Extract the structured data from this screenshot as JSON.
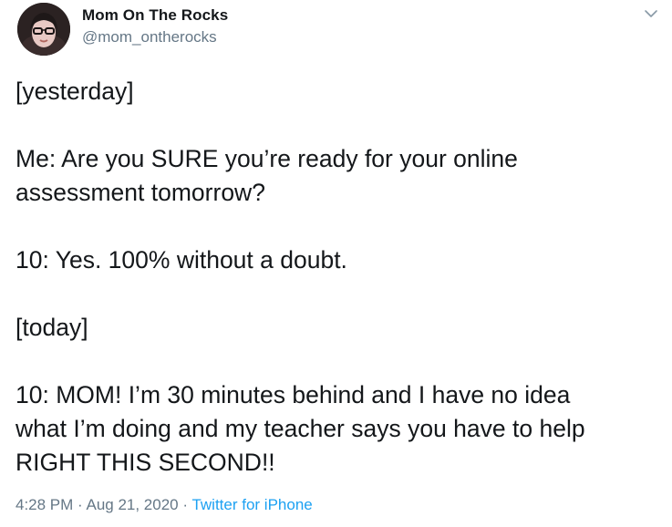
{
  "author": {
    "display_name": "Mom On The Rocks",
    "handle": "@mom_ontherocks"
  },
  "icons": {
    "menu": "chevron-down-icon",
    "avatar": "profile-photo"
  },
  "tweet": {
    "lines": [
      "[yesterday]",
      "",
      "Me: Are you SURE you’re ready for your online",
      "assessment tomorrow?",
      "",
      "10: Yes. 100% without a doubt.",
      "",
      "[today]",
      "",
      "10: MOM! I’m 30 minutes behind and I have no idea",
      "what I’m doing and my teacher says you have to help",
      "RIGHT THIS SECOND!!"
    ]
  },
  "meta": {
    "time": "4:28 PM",
    "separator1": " · ",
    "date": "Aug 21, 2020",
    "separator2": " · ",
    "source": "Twitter for iPhone"
  },
  "colors": {
    "text": "#14171a",
    "secondary": "#657786",
    "link": "#1da1f2"
  }
}
